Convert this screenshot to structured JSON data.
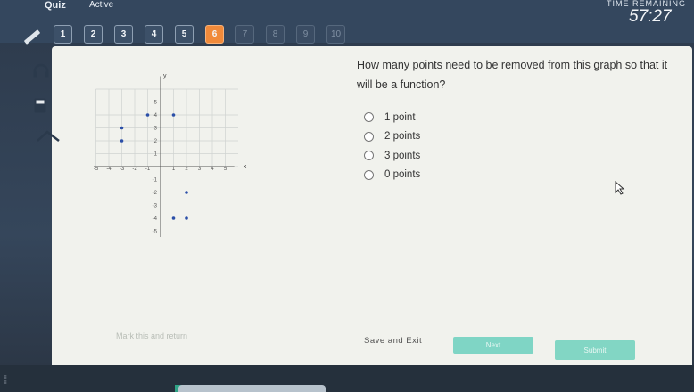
{
  "header": {
    "title": "Quiz",
    "status": "Active",
    "time_label": "TIME REMAINING",
    "timer": "57:27"
  },
  "question_nav": [
    {
      "label": "1"
    },
    {
      "label": "2"
    },
    {
      "label": "3"
    },
    {
      "label": "4"
    },
    {
      "label": "5"
    },
    {
      "label": "6"
    },
    {
      "label": "7"
    },
    {
      "label": "8"
    },
    {
      "label": "9"
    },
    {
      "label": "10"
    }
  ],
  "current_question": "6",
  "tools": [
    "pencil-icon",
    "headphones-icon",
    "calculator-icon",
    "line-tool-icon"
  ],
  "question": {
    "text": "How many points need to be removed from this graph so that it will be a function?",
    "options": [
      "1 point",
      "2 points",
      "3 points",
      "0 points"
    ]
  },
  "graph": {
    "x_axis_label": "x",
    "y_axis_label": "y",
    "x_ticks": [
      "-5",
      "-4",
      "-3",
      "-2",
      "-1",
      "1",
      "2",
      "3",
      "4",
      "5"
    ],
    "y_ticks": [
      "5",
      "4",
      "3",
      "2",
      "1",
      "-1",
      "-2",
      "-3",
      "-4",
      "-5"
    ],
    "points": [
      {
        "x": -1,
        "y": 4
      },
      {
        "x": 1,
        "y": 4
      },
      {
        "x": -3,
        "y": 3
      },
      {
        "x": -3,
        "y": 2
      },
      {
        "x": 2,
        "y": -2
      },
      {
        "x": 1,
        "y": -4
      },
      {
        "x": 2,
        "y": -4
      }
    ],
    "point_color": "#2b4fa8"
  },
  "footer": {
    "link_text": "Mark this and return",
    "save_exit": "Save and Exit",
    "next_label": "Next",
    "submit_label": "Submit"
  },
  "colors": {
    "current_question": "#f18a3a",
    "accent_button": "#7fd5c5"
  }
}
